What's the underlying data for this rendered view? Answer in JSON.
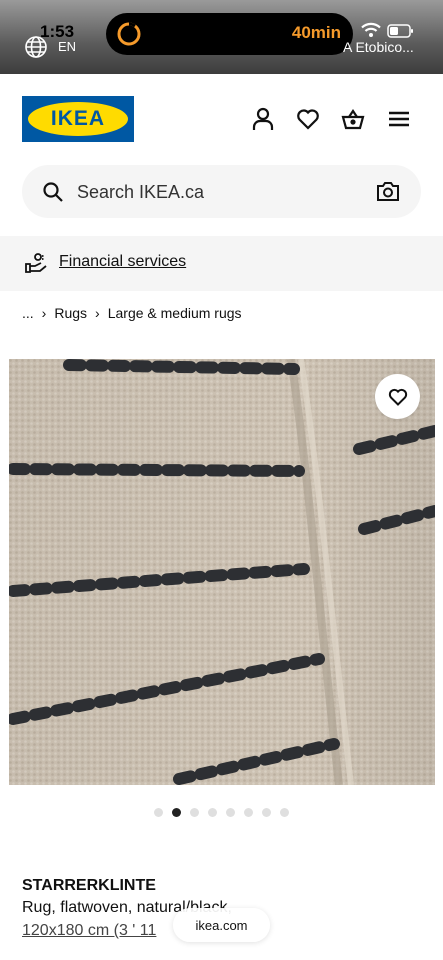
{
  "status_bar": {
    "time": "1:53",
    "language": "EN",
    "timer": "40min",
    "tab_hint": "A Etobico..."
  },
  "header": {
    "logo_text": "IKEA",
    "icons": [
      "person-icon",
      "heart-icon",
      "basket-icon",
      "menu-icon"
    ]
  },
  "search": {
    "placeholder": "Search IKEA.ca"
  },
  "financial": {
    "label": "Financial services"
  },
  "breadcrumb": {
    "ellipsis": "...",
    "items": [
      "Rugs",
      "Large & medium rugs"
    ]
  },
  "gallery": {
    "slide_count": 8,
    "active_index": 1
  },
  "product": {
    "name": "STARRERKLINTE",
    "description": "Rug, flatwoven, natural/black,",
    "size": "120x180 cm (3 ' 11"
  },
  "browser": {
    "url": "ikea.com"
  },
  "colors": {
    "ikea_blue": "#0058a3",
    "ikea_yellow": "#ffdb00",
    "timer_orange": "#f59a2b"
  }
}
